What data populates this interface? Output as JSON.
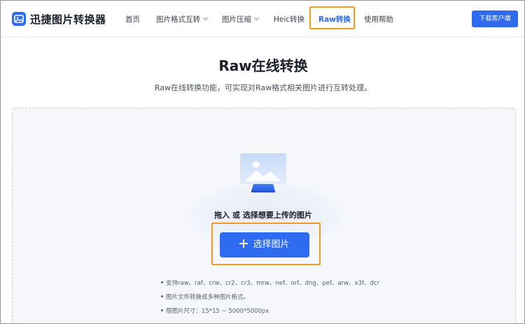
{
  "app": {
    "name": "迅捷图片转换器"
  },
  "nav": {
    "items": [
      {
        "label": "首页",
        "dropdown": false,
        "active": false
      },
      {
        "label": "图片格式互转",
        "dropdown": true,
        "active": false
      },
      {
        "label": "图片压缩",
        "dropdown": true,
        "active": false
      },
      {
        "label": "Heic转换",
        "dropdown": false,
        "active": false
      },
      {
        "label": "Raw转换",
        "dropdown": false,
        "active": true
      },
      {
        "label": "使用帮助",
        "dropdown": false,
        "active": false
      }
    ],
    "download_label": "下载客户端"
  },
  "main": {
    "title": "Raw在线转换",
    "subtitle": "Raw在线转换功能，可实现对Raw格式相关图片进行互转处理。",
    "drop_hint": "拖入 或 选择想要上传的图片",
    "select_label": "选择图片",
    "info": [
      "支持raw、raf、crw、cr2、cr3、mrw、nef、orf、dng、pef、arw、x3f、dcr",
      "图片文件转换成多种图片格式。",
      "限图片尺寸：15*15 ~ 5000*5000px"
    ]
  },
  "colors": {
    "accent": "#2f6bf0",
    "highlight_border": "#f39b1f",
    "text_dark": "#1b1f2a"
  },
  "icons": {
    "logo": "image-logo-icon",
    "dropdown": "chevron-down-icon",
    "add": "plus-icon",
    "upload_illustration": "image-upload-illustration-icon"
  }
}
